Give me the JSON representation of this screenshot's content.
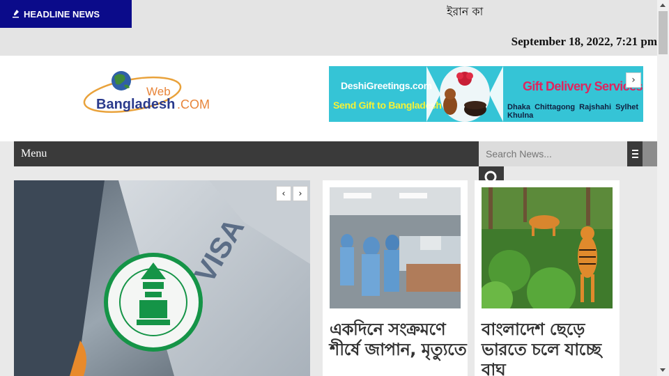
{
  "topbar": {
    "headline_label": "HEADLINE NEWS",
    "ticker_text": "ইরান কা",
    "datetime": "September 18, 2022, 7:21 pm"
  },
  "header": {
    "logo": {
      "line1": "Web",
      "line2": "Bangladesh",
      "suffix": ".COM"
    },
    "ad": {
      "site": "DeshiGreetings.com",
      "tagline": "Send Gift to Bangladesh",
      "service": "Gift Delivery Services",
      "cities": "Dhaka Chittagong Rajshahi Sylhet Khulna"
    }
  },
  "nav": {
    "menu_label": "Menu",
    "search_placeholder": "Search News..."
  },
  "content": {
    "cards": [
      {
        "title": "একদিনে সংক্রমণে শীর্ষে জাপান, মৃত্যুতে"
      },
      {
        "title": "বাংলাদেশ ছেড়ে ভারতে চলে যাচ্ছে বাঘ"
      }
    ]
  },
  "colors": {
    "headline_bg": "#0b0b8a",
    "nav_bg": "#3a3a3a",
    "ad_bg": "#35c4d6",
    "card_title": "#333333"
  }
}
